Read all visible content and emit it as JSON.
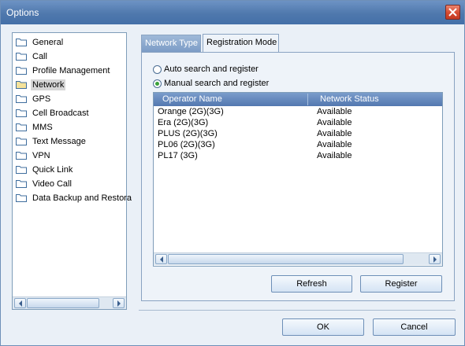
{
  "window": {
    "title": "Options"
  },
  "tree": {
    "items": [
      {
        "label": "General"
      },
      {
        "label": "Call"
      },
      {
        "label": "Profile Management"
      },
      {
        "label": "Network",
        "selected": true
      },
      {
        "label": "GPS"
      },
      {
        "label": "Cell Broadcast"
      },
      {
        "label": "MMS"
      },
      {
        "label": "Text Message"
      },
      {
        "label": "VPN"
      },
      {
        "label": "Quick Link"
      },
      {
        "label": "Video Call"
      },
      {
        "label": "Data Backup and Restora"
      }
    ]
  },
  "tabs": [
    {
      "label": "Network Type"
    },
    {
      "label": "Registration Mode"
    }
  ],
  "registration": {
    "auto_label": "Auto search and register",
    "manual_label": "Manual search and register",
    "selected": "manual"
  },
  "operators": {
    "columns": [
      "Operator Name",
      "Network Status"
    ],
    "rows": [
      [
        "Orange (2G)(3G)",
        "Available"
      ],
      [
        "Era (2G)(3G)",
        "Available"
      ],
      [
        "PLUS (2G)(3G)",
        "Available"
      ],
      [
        "PL06 (2G)(3G)",
        "Available"
      ],
      [
        "PL17 (3G)",
        "Available"
      ]
    ]
  },
  "buttons": {
    "refresh": "Refresh",
    "register": "Register",
    "ok": "OK",
    "cancel": "Cancel"
  },
  "colors": {
    "titlebar": "#4f78ad",
    "close_button": "#d64a30",
    "list_header": "#5378b0",
    "selected_radio": "#3aa13a"
  }
}
